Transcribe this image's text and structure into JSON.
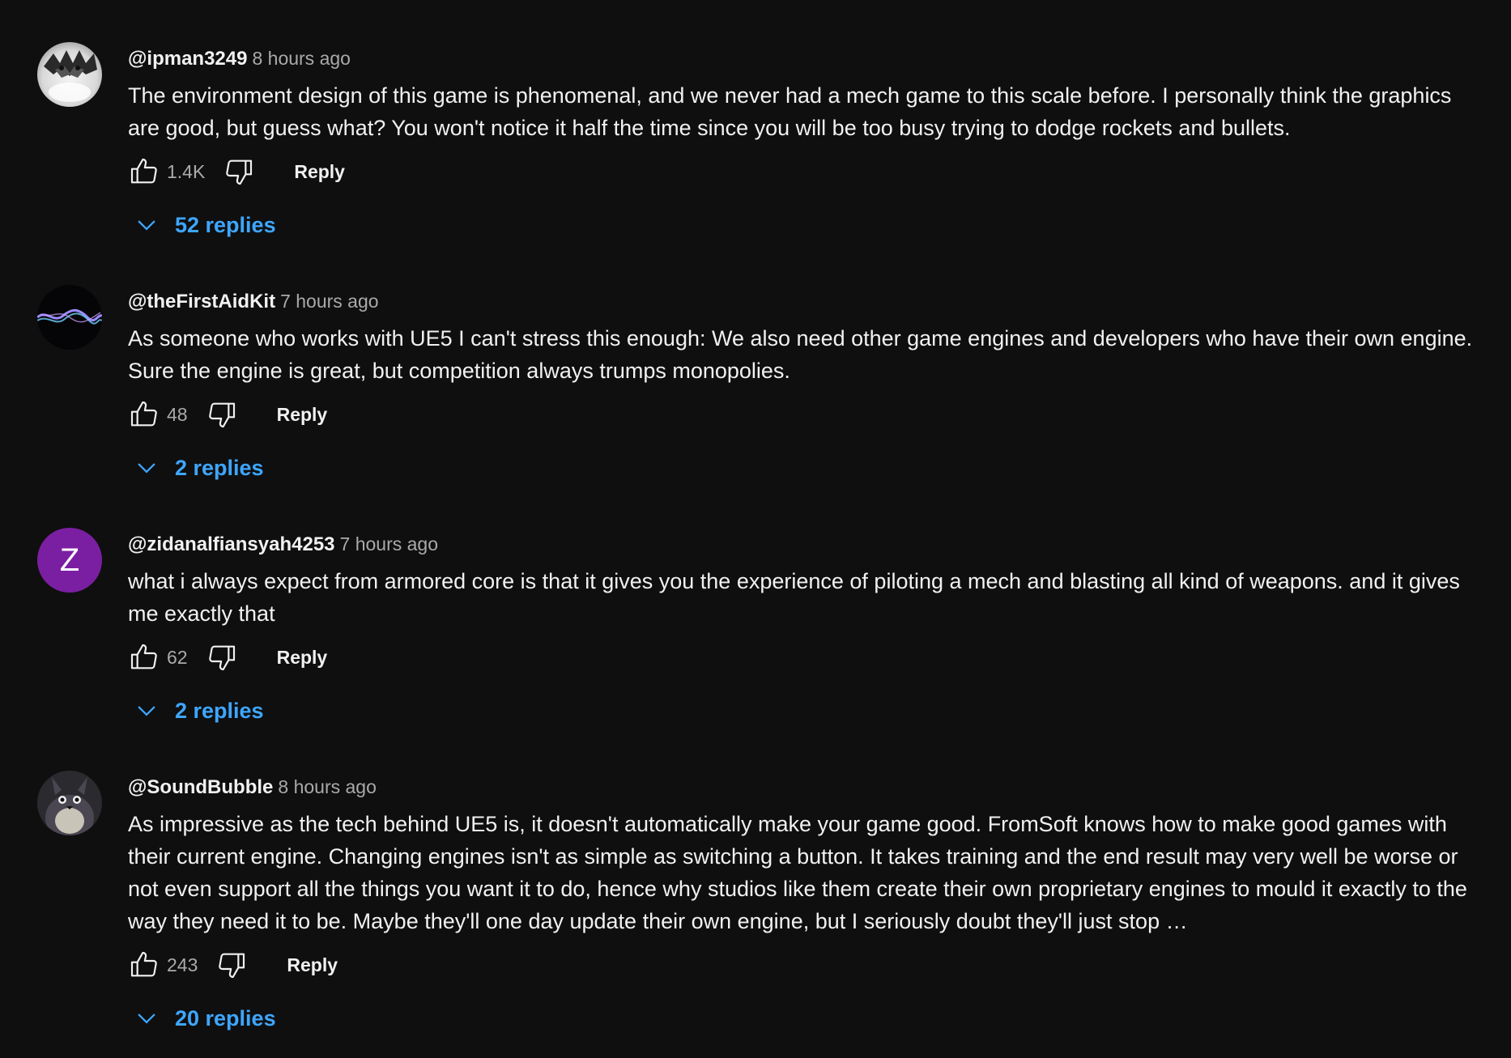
{
  "comments": [
    {
      "author": "@ipman3249",
      "time": "8 hours ago",
      "text": "The environment design of this game is phenomenal, and we never had a mech game to this scale before. I personally think the graphics are good, but guess what? You won't notice it half the time since you will be too busy trying to dodge rockets and bullets.",
      "likes": "1.4K",
      "reply_label": "Reply",
      "replies_label": "52 replies",
      "avatar_icon": "ipman3249-avatar"
    },
    {
      "author": "@theFirstAidKit",
      "time": "7 hours ago",
      "text": "As someone who works with UE5 I can't stress this enough: We also need other game engines and developers who have their own engine. Sure the engine is great, but competition always trumps monopolies.",
      "likes": "48",
      "reply_label": "Reply",
      "replies_label": "2 replies",
      "avatar_icon": "thefirstaidkit-avatar"
    },
    {
      "author": "@zidanalfiansyah4253",
      "time": "7 hours ago",
      "text": "what i always expect from armored core is that it gives you the experience of piloting a mech and blasting all kind of weapons. and it gives me exactly that",
      "likes": "62",
      "reply_label": "Reply",
      "replies_label": "2 replies",
      "avatar_letter": "Z",
      "avatar_color": "#7b1fa2"
    },
    {
      "author": "@SoundBubble",
      "time": "8 hours ago",
      "text": "As impressive as the tech behind UE5 is, it doesn't automatically make your game good. FromSoft knows how to make good games with their current engine. Changing engines isn't as simple as switching a button. It takes training and the end result may very well be worse or not even support all the things you want it to do, hence why studios like them create their own proprietary engines to mould it exactly to the way they need it to be. Maybe they'll one day update their own engine, but I seriously doubt they'll just stop …",
      "likes": "243",
      "reply_label": "Reply",
      "replies_label": "20 replies",
      "avatar_icon": "soundbubble-avatar"
    }
  ],
  "colors": {
    "background": "#0f0f0f",
    "text": "#f1f1f1",
    "secondary": "#aaaaaa",
    "link": "#3ea6ff"
  }
}
